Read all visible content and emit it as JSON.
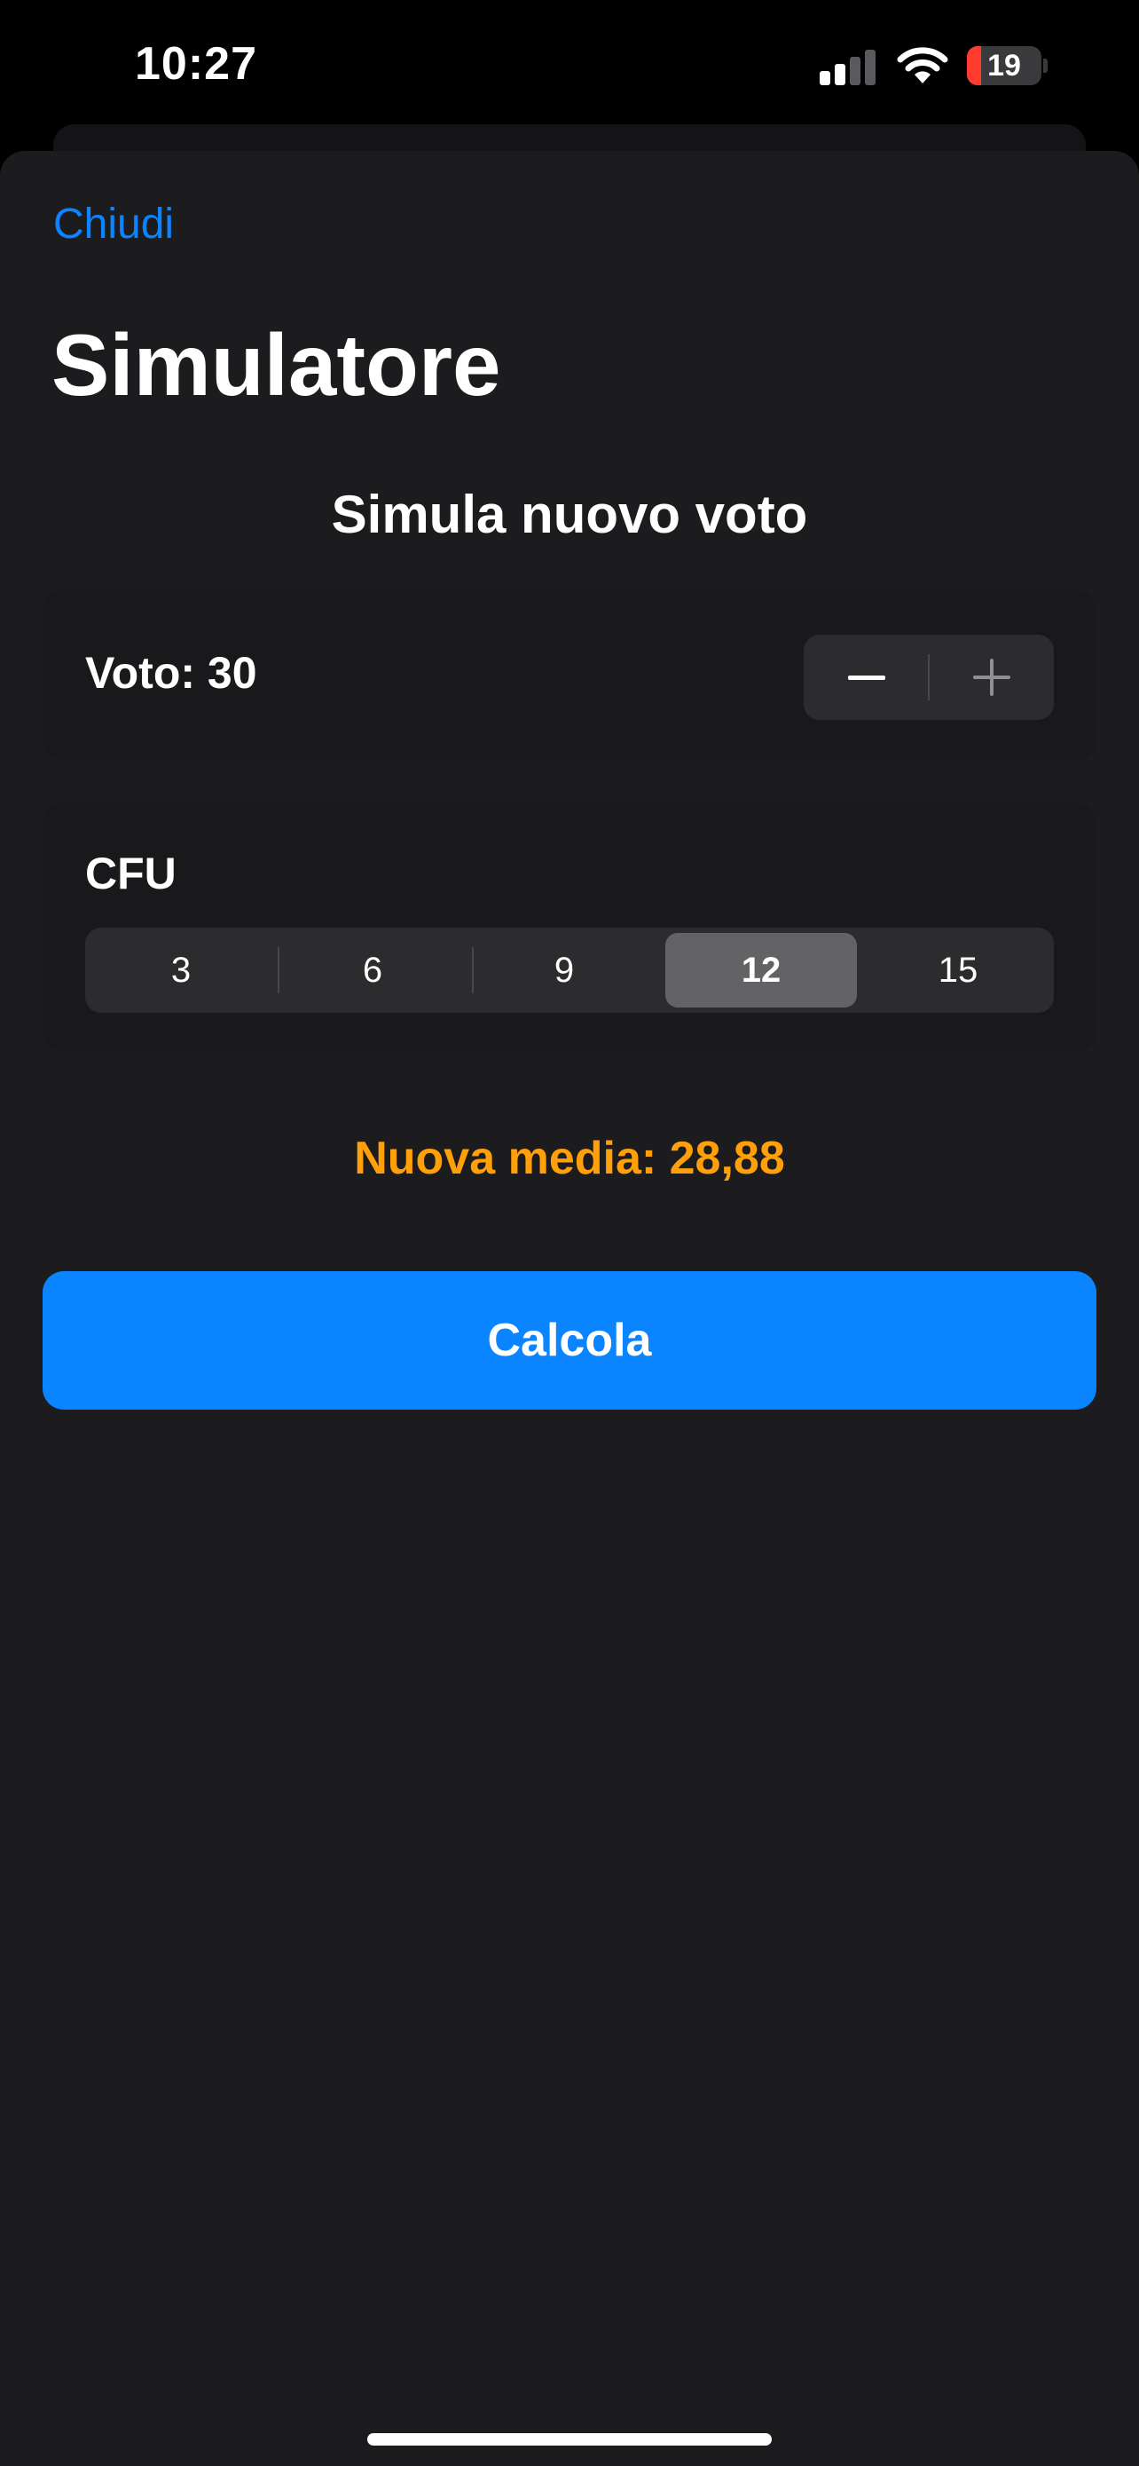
{
  "status_bar": {
    "time": "10:27",
    "battery_level": "19",
    "battery_fraction": 0.19,
    "signal_bars_active": 2,
    "signal_bars_total": 4,
    "icons": [
      "signal-icon",
      "wifi-icon",
      "battery-icon"
    ]
  },
  "sheet": {
    "close_label": "Chiudi",
    "title": "Simulatore",
    "section_title": "Simula nuovo voto"
  },
  "voto": {
    "label": "Voto: 30",
    "stepper": {
      "decrement_icon": "minus-icon",
      "increment_icon": "plus-icon"
    }
  },
  "cfu": {
    "label": "CFU",
    "options": [
      "3",
      "6",
      "9",
      "12",
      "15"
    ],
    "selected": "12"
  },
  "result": {
    "text": "Nuova media: 28,88"
  },
  "actions": {
    "calculate_label": "Calcola"
  },
  "colors": {
    "accent_blue": "#0a84ff",
    "result_orange": "#ff9f0a",
    "battery_low_red": "#ff3b30",
    "sheet_background": "#1c1c1e"
  }
}
